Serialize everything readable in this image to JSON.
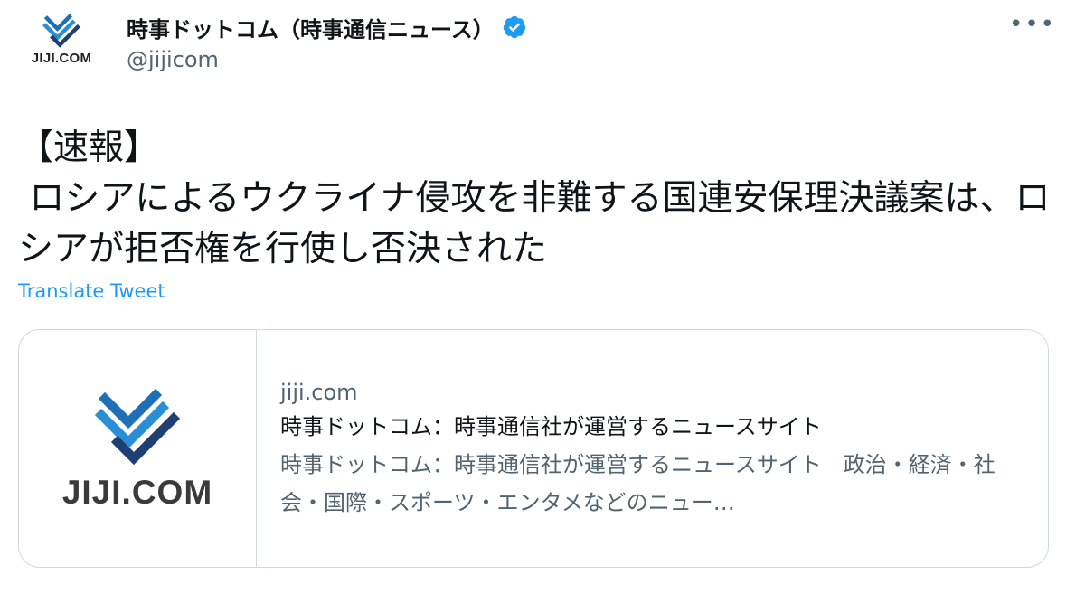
{
  "author": {
    "avatar_label": "JIJI.COM",
    "display_name": "時事ドットコム（時事通信ニュース）",
    "handle": "@jijicom",
    "verified": true
  },
  "menu": {
    "more_label": "•••"
  },
  "tweet": {
    "text": "【速報】\n ロシアによるウクライナ侵攻を非難する国連安保理決議案は、ロシアが拒否権を行使し否決された",
    "translate_label": "Translate Tweet"
  },
  "card": {
    "logo_text": "JIJI.COM",
    "domain": "jiji.com",
    "title": "時事ドットコム：時事通信社が運営するニュースサイト",
    "description": "時事ドットコム：時事通信社が運営するニュースサイト　政治・経済・社会・国際・スポーツ・エンタメなどのニュー…"
  },
  "colors": {
    "link": "#1d9bf0",
    "secondary_text": "#536471",
    "border": "#cfd9de",
    "logo_blue": "#1f6fb5",
    "logo_navy": "#1f3f73"
  }
}
